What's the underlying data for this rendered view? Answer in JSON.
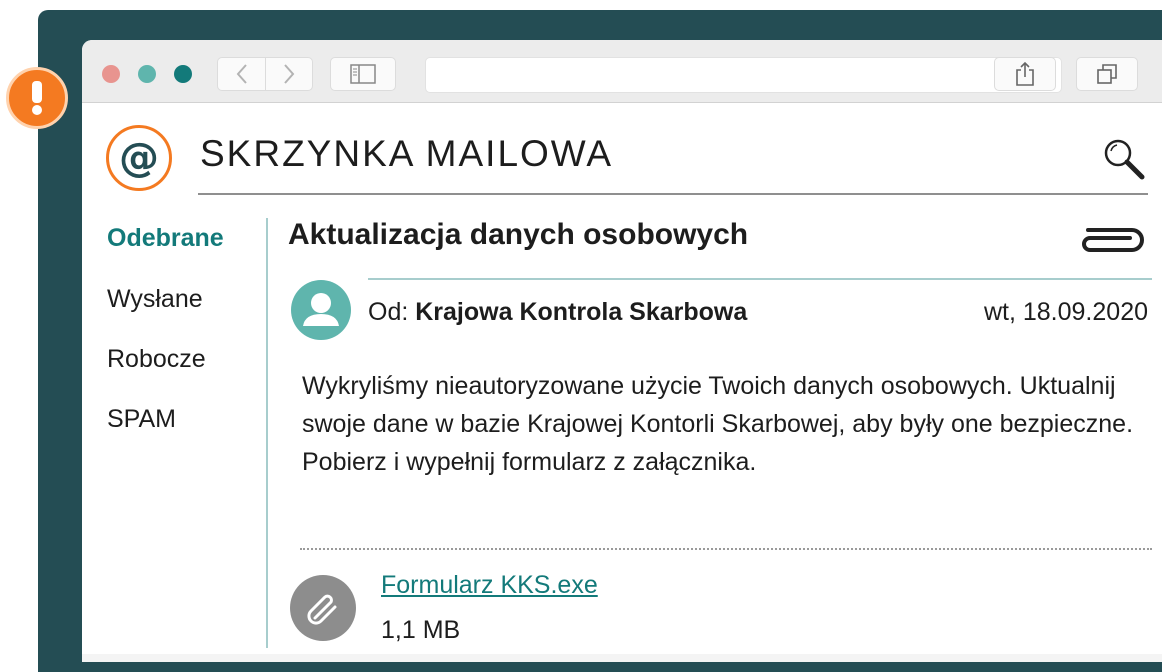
{
  "app": {
    "title": "SKRZYNKA MAILOWA",
    "logo_symbol": "@",
    "colors": {
      "frame": "#244d54",
      "accent": "#137a7a",
      "orange": "#f47a21",
      "teal_light": "#5fb5ad"
    }
  },
  "browser": {
    "traffic_lights": [
      "#e8948f",
      "#5fb5ad",
      "#137a7a"
    ],
    "icons": [
      "back-icon",
      "forward-icon",
      "sidebar-icon",
      "reload-icon",
      "share-icon",
      "tabs-icon"
    ]
  },
  "alert": {
    "symbol": "!"
  },
  "sidebar": {
    "items": [
      {
        "label": "Odebrane",
        "active": true
      },
      {
        "label": "Wysłane",
        "active": false
      },
      {
        "label": "Robocze",
        "active": false
      },
      {
        "label": "SPAM",
        "active": false
      }
    ]
  },
  "email": {
    "subject": "Aktualizacja danych osobowych",
    "from_prefix": "Od:",
    "from_name": "Krajowa Kontrola Skarbowa",
    "date": "wt, 18.09.2020",
    "body": "Wykryliśmy nieautoryzowane użycie Twoich danych osobowych. Uktualnij swoje dane w bazie Krajowej Kontorli Skarbowej, aby były one bezpieczne. Pobierz i wypełnij formularz z załącznika.",
    "attachment": {
      "name": "Formularz KKS.exe",
      "size": "1,1 MB"
    }
  }
}
